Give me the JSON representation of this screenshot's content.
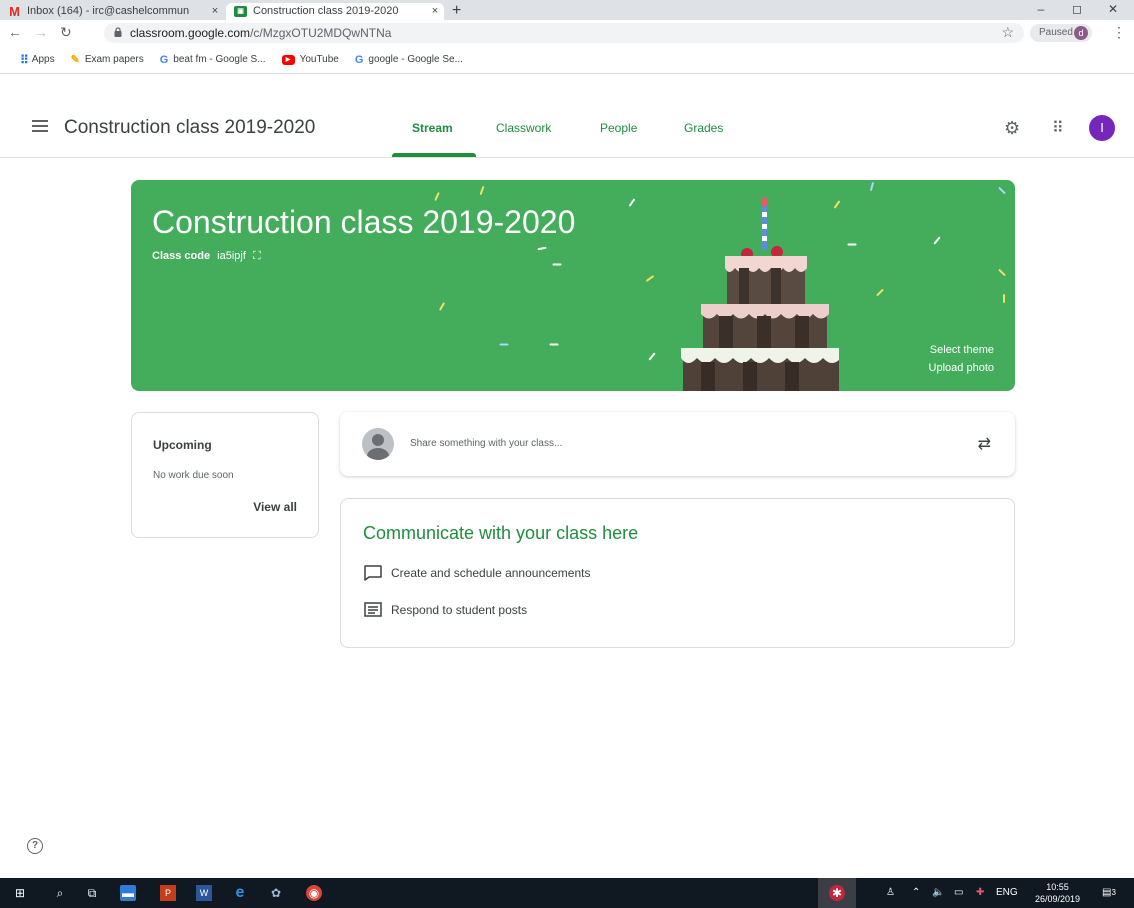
{
  "browser": {
    "tabs": [
      {
        "title": "Inbox (164) - irc@cashelcommun",
        "close": "×"
      },
      {
        "title": "Construction class 2019-2020",
        "close": "×"
      }
    ],
    "new_tab": "+",
    "window_controls": {
      "minimize": "–",
      "restore": "◻",
      "close": "✕"
    },
    "url_host": "classroom.google.com",
    "url_path": "/c/MzgxOTU2MDQwNTNa",
    "profile_status": "Paused",
    "profile_initial": "d",
    "bookmarks": [
      {
        "label": "Apps",
        "icon": "apps-icon"
      },
      {
        "label": "Exam papers",
        "icon": "pen-icon"
      },
      {
        "label": "beat fm - Google S...",
        "icon": "google-icon"
      },
      {
        "label": "YouTube",
        "icon": "youtube-icon"
      },
      {
        "label": "google - Google Se...",
        "icon": "google-icon"
      }
    ]
  },
  "header": {
    "title": "Construction class 2019-2020",
    "tabs": [
      "Stream",
      "Classwork",
      "People",
      "Grades"
    ],
    "active_tab": "Stream",
    "avatar_initial": "I",
    "avatar_color": "#7627bb"
  },
  "banner": {
    "title": "Construction class 2019-2020",
    "code_label": "Class code",
    "code": "ia5ipjf",
    "select_theme": "Select theme",
    "upload_photo": "Upload photo",
    "color": "#43ad5c"
  },
  "upcoming": {
    "title": "Upcoming",
    "status": "No work due soon",
    "view_all": "View all"
  },
  "share": {
    "placeholder": "Share something with your class..."
  },
  "communicate": {
    "title": "Communicate with your class here",
    "items": [
      {
        "label": "Create and schedule announcements",
        "icon": "announcement-icon"
      },
      {
        "label": "Respond to student posts",
        "icon": "posts-icon"
      }
    ]
  },
  "taskbar": {
    "language": "ENG",
    "time": "10:55",
    "date": "26/09/2019",
    "notifications": "3"
  }
}
